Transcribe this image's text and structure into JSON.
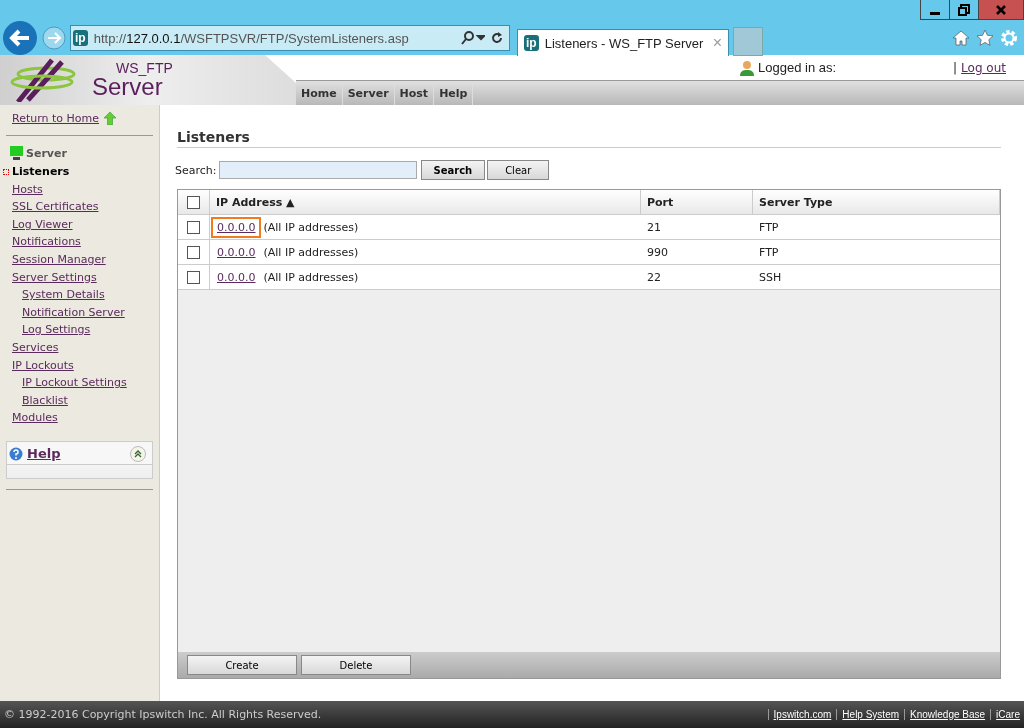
{
  "browser": {
    "site_badge": "ip",
    "url_prefix": "http://",
    "url_host": "127.0.0.1",
    "url_path": "/WSFTPSVR/FTP/SystemListeners.asp",
    "tab_badge": "ip",
    "tab_title": "Listeners - WS_FTP Server",
    "tab_close": "×"
  },
  "header": {
    "logo_top": "WS_FTP",
    "logo_bottom": "Server",
    "logged_in": "Logged in as:",
    "separator": "|",
    "logout": "Log out",
    "nav": [
      {
        "label": "Home"
      },
      {
        "label": "Server"
      },
      {
        "label": "Host"
      },
      {
        "label": "Help"
      }
    ]
  },
  "sidebar": {
    "return_home": "Return to Home",
    "section": "Server",
    "items": [
      {
        "label": "Listeners",
        "selected": true
      },
      {
        "label": "Hosts",
        "selected": false
      },
      {
        "label": "SSL Certificates",
        "selected": false
      },
      {
        "label": "Log Viewer",
        "selected": false
      },
      {
        "label": "Notifications",
        "selected": false
      },
      {
        "label": "Session Manager",
        "selected": false
      },
      {
        "label": "Server Settings",
        "selected": false,
        "children": [
          {
            "label": "System Details",
            "selected": false
          },
          {
            "label": "Notification Server",
            "selected": false
          },
          {
            "label": "Log Settings",
            "selected": false
          }
        ]
      },
      {
        "label": "Services",
        "selected": false
      },
      {
        "label": "IP Lockouts",
        "selected": false,
        "children": [
          {
            "label": "IP Lockout Settings",
            "selected": false
          },
          {
            "label": "Blacklist",
            "selected": false
          }
        ]
      },
      {
        "label": "Modules",
        "selected": false
      }
    ],
    "help_title": "Help"
  },
  "page": {
    "title": "Listeners",
    "search_label": "Search:",
    "search_button": "Search",
    "clear_button": "Clear",
    "table": {
      "columns": [
        "IP Address ▲",
        "Port",
        "Server Type"
      ],
      "all_checked": false,
      "rows": [
        {
          "ip": "0.0.0.0",
          "note": "(All IP addresses)",
          "port": "21",
          "type": "FTP",
          "checked": false,
          "focused": true
        },
        {
          "ip": "0.0.0.0",
          "note": "(All IP addresses)",
          "port": "990",
          "type": "FTP",
          "checked": false,
          "focused": false
        },
        {
          "ip": "0.0.0.0",
          "note": "(All IP addresses)",
          "port": "22",
          "type": "SSH",
          "checked": false,
          "focused": false
        }
      ]
    },
    "create_button": "Create",
    "delete_button": "Delete"
  },
  "footer": {
    "copyright": "© 1992-2016 Copyright Ipswitch Inc. All Rights Reserved.",
    "links": [
      "Ipswitch.com",
      "Help System",
      "Knowledge Base",
      "iCare"
    ]
  }
}
